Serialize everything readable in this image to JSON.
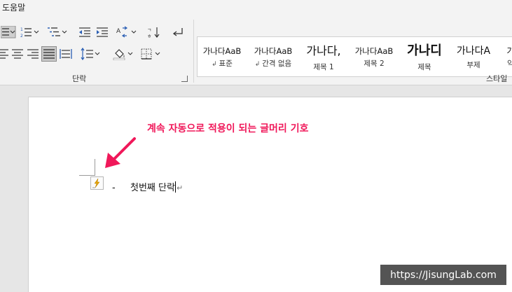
{
  "menubar": {
    "help_label": "도움말"
  },
  "ribbon": {
    "paragraph_group_label": "단락",
    "styles_group_label": "스타일",
    "styles": [
      {
        "preview": "가나다AaB",
        "label": "표준"
      },
      {
        "preview": "가나다AaB",
        "label": "간격 없음"
      },
      {
        "preview": "가나다,",
        "label": "제목 1"
      },
      {
        "preview": "가나다AaB",
        "label": "제목 2"
      },
      {
        "preview": "가나디",
        "label": "제목"
      },
      {
        "preview": "가나다A",
        "label": "부제"
      },
      {
        "preview": "가",
        "label": "약"
      }
    ]
  },
  "document": {
    "annotation": "계속 자동으로 적용이 되는 글머리 기호",
    "bullet_char": "-",
    "paragraph_text": "첫번째 단락",
    "paragraph_mark": "↵"
  },
  "colors": {
    "annotation": "#f0185a",
    "arrow": "#f0185a",
    "ribbon_bg": "#f3f3f3",
    "doc_bg": "#e6e6e6",
    "autocorrect_icon": "#e8a400"
  },
  "watermark": {
    "text": "https://JisungLab.com"
  }
}
